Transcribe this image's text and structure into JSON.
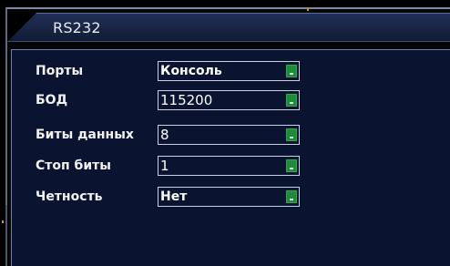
{
  "window": {
    "title": "RS232"
  },
  "colors": {
    "title_bar": "#1a2748",
    "panel_bg": "#0a1430",
    "dropdown_button": "#1f8a3a",
    "text": "#ffffff"
  },
  "settings": {
    "ports": {
      "label": "Порты",
      "value": "Консоль",
      "icon": "dropdown-arrow-icon"
    },
    "baud": {
      "label": "БОД",
      "value": "115200",
      "icon": "dropdown-arrow-icon"
    },
    "data_bits": {
      "label": "Биты данных",
      "value": "8",
      "icon": "dropdown-arrow-icon"
    },
    "stop_bits": {
      "label": "Стоп биты",
      "value": "1",
      "icon": "dropdown-arrow-icon"
    },
    "parity": {
      "label": "Четность",
      "value": "Нет",
      "icon": "dropdown-arrow-icon"
    }
  }
}
